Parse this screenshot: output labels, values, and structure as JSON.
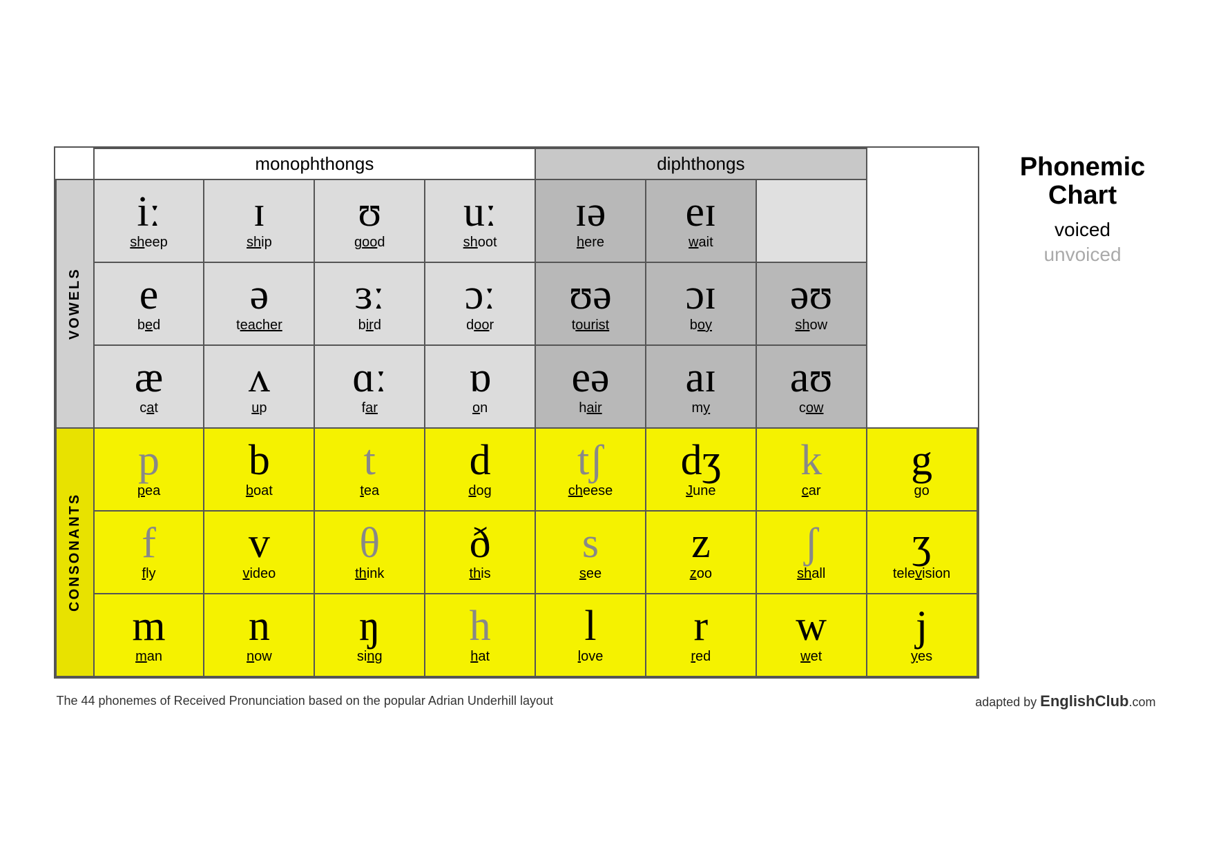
{
  "title": "Phonemic Chart",
  "legend": {
    "title": "Phonemic\nChart",
    "voiced": "voiced",
    "unvoiced": "unvoiced"
  },
  "sections": {
    "monophthongs": "monophthongs",
    "diphthongs": "diphthongs"
  },
  "side_labels": {
    "vowels": "VOWELS",
    "consonants": "CONSONANTS"
  },
  "vowel_rows": [
    {
      "cells": [
        {
          "symbol": "iː",
          "word_before": "",
          "word_underline": "sh",
          "word_after": "eep",
          "bg": "light"
        },
        {
          "symbol": "ɪ",
          "word_before": "",
          "word_underline": "sh",
          "word_after": "ip",
          "bg": "light"
        },
        {
          "symbol": "ʊ",
          "word_before": "",
          "word_underline": "g",
          "word_after": "oo",
          "word_underline2": "d",
          "bg": "light"
        },
        {
          "symbol": "uː",
          "word_before": "",
          "word_underline": "sh",
          "word_after": "oot",
          "bg": "light"
        },
        {
          "symbol": "ɪə",
          "word_before": "",
          "word_underline": "h",
          "word_after": "ere",
          "bg": "diph"
        },
        {
          "symbol": "eɪ",
          "word_before": "",
          "word_underline": "w",
          "word_after": "ait",
          "bg": "diph"
        },
        {
          "symbol": "",
          "word": "",
          "bg": "empty"
        }
      ]
    },
    {
      "cells": [
        {
          "symbol": "e",
          "word_before": "b",
          "word_underline": "e",
          "word_after": "d",
          "bg": "light"
        },
        {
          "symbol": "ə",
          "word_before": "t",
          "word_underline": "eacher",
          "word_after": "",
          "bg": "light"
        },
        {
          "symbol": "ɜː",
          "word_before": "b",
          "word_underline": "ir",
          "word_after": "d",
          "bg": "light"
        },
        {
          "symbol": "ɔː",
          "word_before": "d",
          "word_underline": "oo",
          "word_after": "r",
          "bg": "light"
        },
        {
          "symbol": "ʊə",
          "word_before": "t",
          "word_underline": "ourist",
          "word_after": "",
          "bg": "diph"
        },
        {
          "symbol": "ɔɪ",
          "word_before": "b",
          "word_underline": "oy",
          "word_after": "",
          "bg": "diph"
        },
        {
          "symbol": "əʊ",
          "word_before": "",
          "word_underline": "sh",
          "word_after": "ow",
          "bg": "diph"
        }
      ]
    },
    {
      "cells": [
        {
          "symbol": "æ",
          "word_before": "c",
          "word_underline": "a",
          "word_after": "t",
          "bg": "light"
        },
        {
          "symbol": "ʌ",
          "word_before": "",
          "word_underline": "u",
          "word_after": "p",
          "bg": "light"
        },
        {
          "symbol": "ɑː",
          "word_before": "f",
          "word_underline": "ar",
          "word_after": "",
          "bg": "light"
        },
        {
          "symbol": "ɒ",
          "word_before": "",
          "word_underline": "o",
          "word_after": "n",
          "bg": "light"
        },
        {
          "symbol": "eə",
          "word_before": "h",
          "word_underline": "air",
          "word_after": "",
          "bg": "diph"
        },
        {
          "symbol": "aɪ",
          "word_before": "m",
          "word_underline": "y",
          "word_after": "",
          "bg": "diph"
        },
        {
          "symbol": "aʊ",
          "word_before": "c",
          "word_underline": "ow",
          "word_after": "",
          "bg": "diph"
        }
      ]
    }
  ],
  "consonant_rows": [
    {
      "cells": [
        {
          "symbol": "p",
          "word_before": "",
          "word_underline": "p",
          "word_after": "ea",
          "voiced": false
        },
        {
          "symbol": "b",
          "word_before": "",
          "word_underline": "b",
          "word_after": "oat",
          "voiced": true
        },
        {
          "symbol": "t",
          "word_before": "",
          "word_underline": "t",
          "word_after": "ea",
          "voiced": false
        },
        {
          "symbol": "d",
          "word_before": "",
          "word_underline": "d",
          "word_after": "og",
          "voiced": true
        },
        {
          "symbol": "tʃ",
          "word_before": "",
          "word_underline": "ch",
          "word_after": "eese",
          "voiced": false
        },
        {
          "symbol": "dʒ",
          "word_before": "",
          "word_underline": "J",
          "word_after": "une",
          "voiced": true
        },
        {
          "symbol": "k",
          "word_before": "",
          "word_underline": "c",
          "word_after": "ar",
          "voiced": false
        },
        {
          "symbol": "g",
          "word_before": "",
          "word_underline": "g",
          "word_after": "o",
          "voiced": true
        }
      ]
    },
    {
      "cells": [
        {
          "symbol": "f",
          "word_before": "",
          "word_underline": "f",
          "word_after": "ly",
          "voiced": false
        },
        {
          "symbol": "v",
          "word_before": "",
          "word_underline": "v",
          "word_after": "ideo",
          "voiced": true
        },
        {
          "symbol": "θ",
          "word_before": "",
          "word_underline": "th",
          "word_after": "ink",
          "voiced": false
        },
        {
          "symbol": "ð",
          "word_before": "",
          "word_underline": "th",
          "word_after": "is",
          "voiced": true
        },
        {
          "symbol": "s",
          "word_before": "",
          "word_underline": "s",
          "word_after": "ee",
          "voiced": false
        },
        {
          "symbol": "z",
          "word_before": "",
          "word_underline": "z",
          "word_after": "oo",
          "voiced": true
        },
        {
          "symbol": "ʃ",
          "word_before": "",
          "word_underline": "sh",
          "word_after": "all",
          "voiced": false
        },
        {
          "symbol": "ʒ",
          "word_before": "tele",
          "word_underline": "v",
          "word_after": "ision",
          "voiced": true
        }
      ]
    },
    {
      "cells": [
        {
          "symbol": "m",
          "word_before": "",
          "word_underline": "m",
          "word_after": "an",
          "voiced": true
        },
        {
          "symbol": "n",
          "word_before": "",
          "word_underline": "n",
          "word_after": "ow",
          "voiced": true
        },
        {
          "symbol": "ŋ",
          "word_before": "si",
          "word_underline": "ng",
          "word_after": "",
          "voiced": true
        },
        {
          "symbol": "h",
          "word_before": "",
          "word_underline": "h",
          "word_after": "at",
          "voiced": false
        },
        {
          "symbol": "l",
          "word_before": "",
          "word_underline": "l",
          "word_after": "ove",
          "voiced": true
        },
        {
          "symbol": "r",
          "word_before": "",
          "word_underline": "r",
          "word_after": "ed",
          "voiced": true
        },
        {
          "symbol": "w",
          "word_before": "",
          "word_underline": "w",
          "word_after": "et",
          "voiced": true
        },
        {
          "symbol": "j",
          "word_before": "",
          "word_underline": "y",
          "word_after": "es",
          "voiced": true
        }
      ]
    }
  ],
  "footer": {
    "left_text": "The 44 phonemes of Received Pronunciation based on the popular Adrian Underhill layout",
    "right_text": "adapted by ",
    "right_brand": "EnglishClub",
    "right_suffix": ".com"
  }
}
